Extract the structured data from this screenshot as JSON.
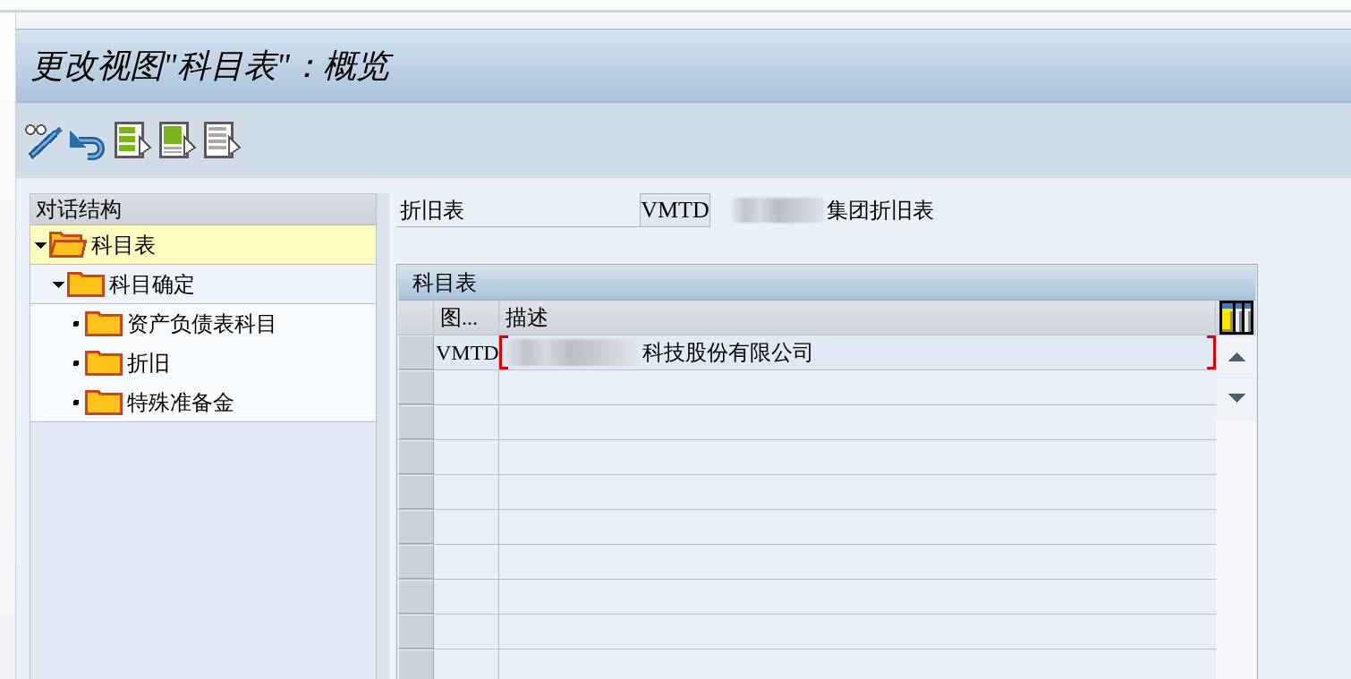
{
  "window": {
    "title": "更改视图\"科目表\"：概览"
  },
  "toolbar": {
    "buttons": [
      {
        "kind": "display-change"
      },
      {
        "kind": "undo"
      },
      {
        "kind": "select-all"
      },
      {
        "kind": "select-block"
      },
      {
        "kind": "deselect-all"
      }
    ]
  },
  "dialog_structure": {
    "title": "对话结构",
    "tree": [
      {
        "label": "科目表",
        "selected": true,
        "expanded": true,
        "children": [
          {
            "label": "科目确定",
            "selected": false,
            "expanded": true,
            "children": [
              {
                "label": "资产负债表科目",
                "selected": false
              },
              {
                "label": "折旧",
                "selected": false
              },
              {
                "label": "特殊准备金",
                "selected": false
              }
            ]
          }
        ]
      }
    ]
  },
  "header_fields": [
    {
      "label": "折旧表",
      "value": "VMTD",
      "redacted": true,
      "description": "集团折旧表"
    }
  ],
  "table": {
    "title": "科目表",
    "columns": [
      {
        "label": "图..."
      },
      {
        "label": "描述"
      }
    ],
    "rows": [
      {
        "cells": [
          "VMTD",
          "科技股份有限公司"
        ],
        "selected": false,
        "focused": true,
        "redacted": true
      }
    ]
  }
}
